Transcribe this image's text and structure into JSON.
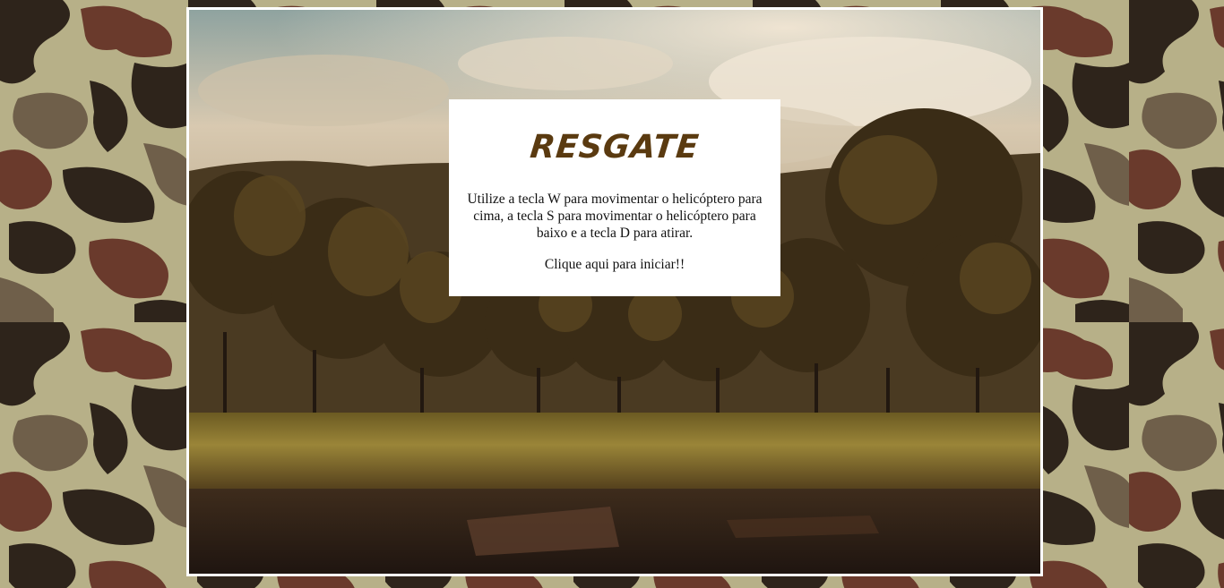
{
  "game": {
    "title": "RESGATE",
    "instructions": "Utilize a tecla W para movimentar o helicóptero para cima, a tecla S para movimentar o helicóptero para baixo e a tecla D para atirar.",
    "start_prompt": "Clique aqui para iniciar!!"
  },
  "colors": {
    "title": "#5a3a10",
    "frame_border": "#ffffff",
    "panel_bg": "#ffffff",
    "camo_light": "#b7b088",
    "camo_mid": "#6f5f4a",
    "camo_dark": "#2e241b",
    "camo_red": "#6a3a2c"
  }
}
